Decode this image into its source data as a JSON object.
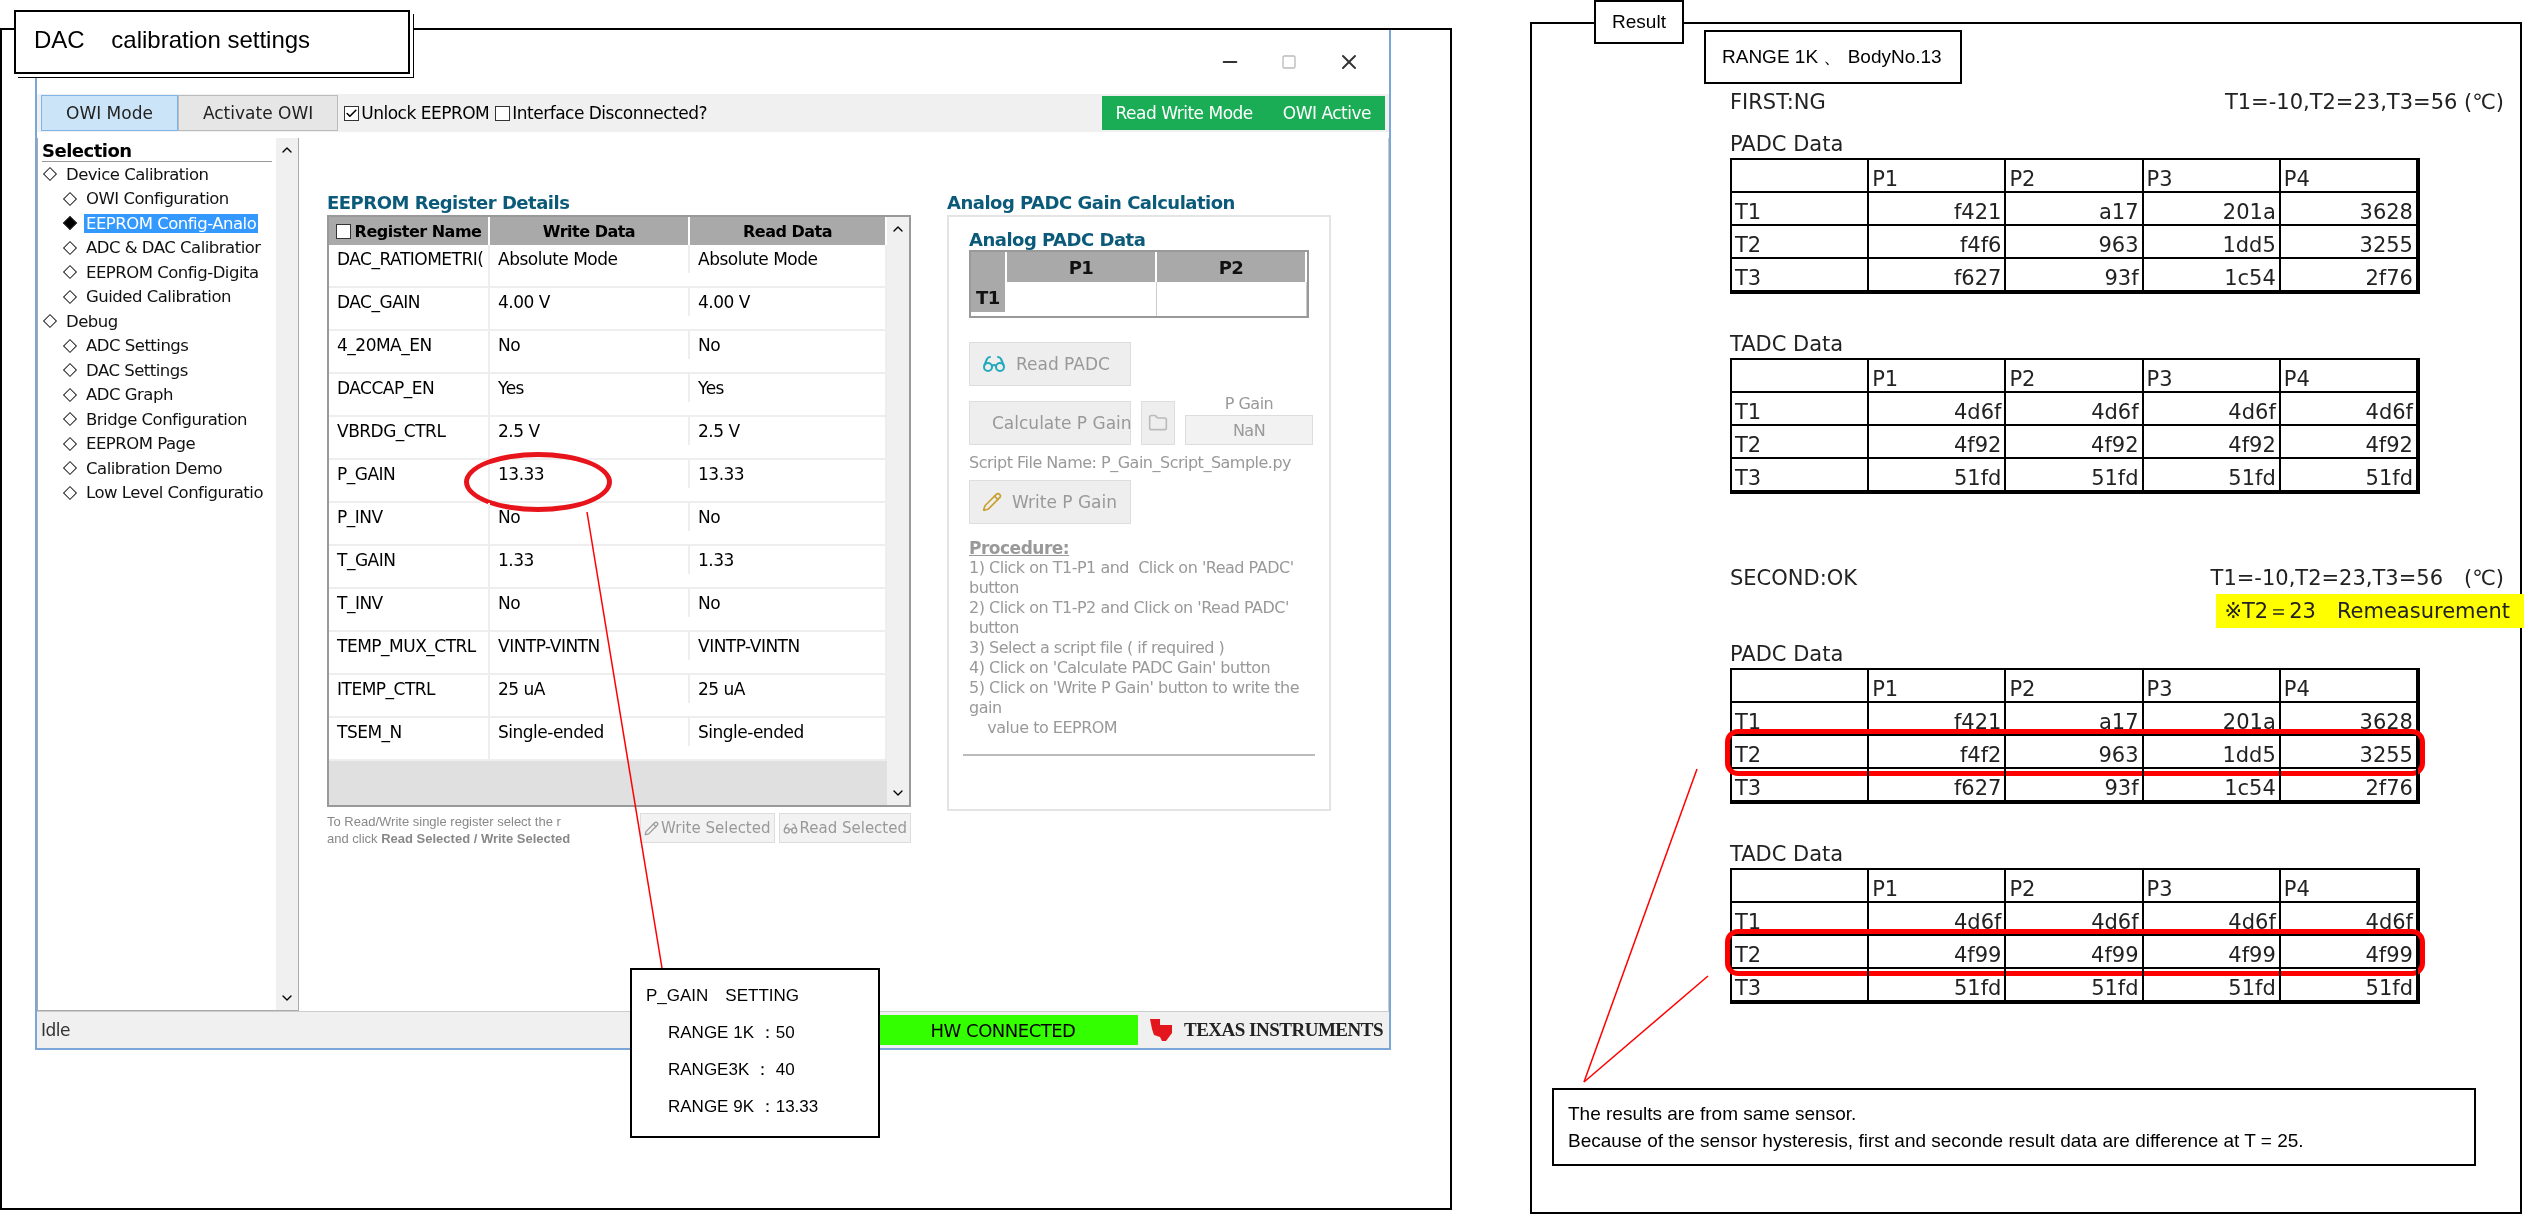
{
  "left_panel": {
    "title": "DAC    calibration settings",
    "app": {
      "toolbar": {
        "modes": [
          {
            "label": "OWI Mode",
            "selected": true
          },
          {
            "label": "Activate OWI",
            "selected": false
          }
        ],
        "checkboxes": [
          {
            "label": "Unlock EEPROM",
            "checked": true
          },
          {
            "label": "Interface Disconnected?",
            "checked": false
          }
        ],
        "status": [
          "Read Write Mode",
          "OWI Active"
        ]
      },
      "sidebar": {
        "heading": "Selection",
        "items": [
          {
            "label": "Device Calibration",
            "selected": false,
            "children": [
              {
                "label": "OWI Configuration",
                "selected": false
              },
              {
                "label": "EEPROM Config-Analo",
                "selected": true
              },
              {
                "label": "ADC & DAC Calibratior",
                "selected": false
              },
              {
                "label": "EEPROM Config-Digita",
                "selected": false
              },
              {
                "label": "Guided Calibration",
                "selected": false
              }
            ]
          },
          {
            "label": "Debug",
            "selected": false,
            "children": [
              {
                "label": "ADC Settings",
                "selected": false
              },
              {
                "label": "DAC Settings",
                "selected": false
              },
              {
                "label": "ADC Graph",
                "selected": false
              },
              {
                "label": "Bridge Configuration",
                "selected": false
              },
              {
                "label": "EEPROM Page",
                "selected": false
              },
              {
                "label": "Calibration Demo",
                "selected": false
              },
              {
                "label": "Low Level Configuratio",
                "selected": false
              }
            ]
          }
        ]
      },
      "registers": {
        "title": "EEPROM Register Details",
        "select_all": false,
        "columns": [
          "Register Name",
          "Write Data",
          "Read Data"
        ],
        "rows": [
          {
            "name": "DAC_RATIOMETRI(",
            "write": "Absolute Mode",
            "read": "Absolute Mode",
            "circled": false
          },
          {
            "name": "DAC_GAIN",
            "write": "4.00 V",
            "read": "4.00 V",
            "circled": false
          },
          {
            "name": "4_20MA_EN",
            "write": "No",
            "read": "No",
            "circled": false
          },
          {
            "name": "DACCAP_EN",
            "write": "Yes",
            "read": "Yes",
            "circled": false
          },
          {
            "name": "VBRDG_CTRL",
            "write": "2.5 V",
            "read": "2.5 V",
            "circled": false
          },
          {
            "name": "P_GAIN",
            "write": "13.33",
            "read": "13.33",
            "circled": true
          },
          {
            "name": "P_INV",
            "write": "No",
            "read": "No",
            "circled": false
          },
          {
            "name": "T_GAIN",
            "write": "1.33",
            "read": "1.33",
            "circled": false
          },
          {
            "name": "T_INV",
            "write": "No",
            "read": "No",
            "circled": false
          },
          {
            "name": "TEMP_MUX_CTRL",
            "write": "VINTP-VINTN",
            "read": "VINTP-VINTN",
            "circled": false
          },
          {
            "name": "ITEMP_CTRL",
            "write": "25 uA",
            "read": "25 uA",
            "circled": false
          },
          {
            "name": "TSEM_N",
            "write": "Single-ended",
            "read": "Single-ended",
            "circled": false
          }
        ],
        "hint": [
          "To Read/Write single register select the r",
          "and click **Read Selected / Write Selected**"
        ],
        "buttons": [
          "Write Selected",
          "Read Selected"
        ]
      },
      "gain": {
        "title": "Analog PADC Gain Calculation",
        "subtitle": "Analog PADC Data",
        "columns": [
          "P1",
          "P2"
        ],
        "row_label": "T1",
        "read_button": "Read PADC",
        "calc_button": "Calculate P Gain",
        "gain_label": "P Gain",
        "gain_value": "NaN",
        "script": "Script File Name: P_Gain_Script_Sample.py",
        "write_button": "Write P Gain",
        "procedure_heading": "Procedure:",
        "procedure": [
          "1) Click on T1-P1 and  Click on 'Read PADC' button",
          "2) Click on T1-P2 and Click on 'Read PADC' button",
          "3) Select a script file ( if required )",
          "4) Click on 'Calculate PADC Gain' button",
          "5) Click on 'Write P Gain' button to write the gain",
          "    value to EEPROM"
        ]
      },
      "status_bar": {
        "state": "Idle",
        "connection": "HW CONNECTED",
        "brand": "TEXAS INSTRUMENTS"
      }
    },
    "callout": {
      "title": "P_GAIN　SETTING",
      "lines": [
        "RANGE 1K ：50",
        "RANGE3K ： 40",
        "RANGE 9K ：13.33"
      ]
    }
  },
  "right_panel": {
    "title": "Result",
    "subtitle": "RANGE 1K 、 BodyNo.13",
    "sections": [
      {
        "heading": "FIRST:NG",
        "temps": "T1=-10,T2=23,T3=56 (℃)",
        "tables": [
          {
            "title": "PADC Data",
            "columns": [
              "P1",
              "P2",
              "P3",
              "P4"
            ],
            "rows": [
              {
                "label": "T1",
                "cells": [
                  "f421",
                  "a17",
                  "201a",
                  "3628"
                ],
                "highlighted": false
              },
              {
                "label": "T2",
                "cells": [
                  "f4f6",
                  "963",
                  "1dd5",
                  "3255"
                ],
                "highlighted": false
              },
              {
                "label": "T3",
                "cells": [
                  "f627",
                  "93f",
                  "1c54",
                  "2f76"
                ],
                "highlighted": false
              }
            ]
          },
          {
            "title": "TADC Data",
            "columns": [
              "P1",
              "P2",
              "P3",
              "P4"
            ],
            "rows": [
              {
                "label": "T1",
                "cells": [
                  "4d6f",
                  "4d6f",
                  "4d6f",
                  "4d6f"
                ],
                "highlighted": false
              },
              {
                "label": "T2",
                "cells": [
                  "4f92",
                  "4f92",
                  "4f92",
                  "4f92"
                ],
                "highlighted": false
              },
              {
                "label": "T3",
                "cells": [
                  "51fd",
                  "51fd",
                  "51fd",
                  "51fd"
                ],
                "highlighted": false
              }
            ]
          }
        ]
      },
      {
        "heading": "SECOND:OK",
        "temps": "T1=-10,T2=23,T3=56　(℃)",
        "note": "※T2＝23　Remeasurement",
        "tables": [
          {
            "title": "PADC Data",
            "columns": [
              "P1",
              "P2",
              "P3",
              "P4"
            ],
            "rows": [
              {
                "label": "T1",
                "cells": [
                  "f421",
                  "a17",
                  "201a",
                  "3628"
                ],
                "highlighted": false
              },
              {
                "label": "T2",
                "cells": [
                  "f4f2",
                  "963",
                  "1dd5",
                  "3255"
                ],
                "highlighted": true
              },
              {
                "label": "T3",
                "cells": [
                  "f627",
                  "93f",
                  "1c54",
                  "2f76"
                ],
                "highlighted": false
              }
            ]
          },
          {
            "title": "TADC Data",
            "columns": [
              "P1",
              "P2",
              "P3",
              "P4"
            ],
            "rows": [
              {
                "label": "T1",
                "cells": [
                  "4d6f",
                  "4d6f",
                  "4d6f",
                  "4d6f"
                ],
                "highlighted": false
              },
              {
                "label": "T2",
                "cells": [
                  "4f99",
                  "4f99",
                  "4f99",
                  "4f99"
                ],
                "highlighted": true
              },
              {
                "label": "T3",
                "cells": [
                  "51fd",
                  "51fd",
                  "51fd",
                  "51fd"
                ],
                "highlighted": false
              }
            ]
          }
        ]
      }
    ],
    "comment": [
      "The results are from same sensor.",
      "Because of the sensor hysteresis, first and seconde result data are difference at T = 25."
    ]
  }
}
